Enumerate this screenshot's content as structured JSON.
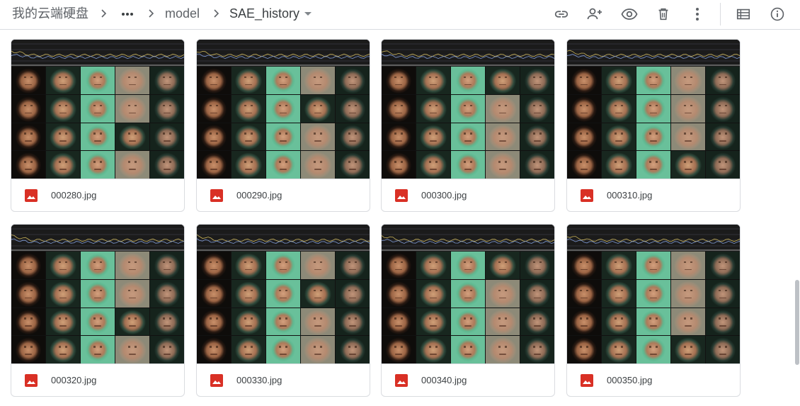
{
  "breadcrumb": {
    "root": "我的云端硬盘",
    "more_label": "More folders",
    "folder": "model",
    "current": "SAE_history"
  },
  "toolbar": {
    "icons": [
      "link-icon",
      "add-person-icon",
      "preview-eye-icon",
      "trash-icon",
      "more-vert-icon",
      "list-view-icon",
      "info-icon"
    ]
  },
  "files": [
    {
      "name": "000280.jpg"
    },
    {
      "name": "000290.jpg"
    },
    {
      "name": "000300.jpg"
    },
    {
      "name": "000310.jpg"
    },
    {
      "name": "000320.jpg"
    },
    {
      "name": "000330.jpg"
    },
    {
      "name": "000340.jpg"
    },
    {
      "name": "000350.jpg"
    }
  ],
  "colors": {
    "image_icon": "#d93025",
    "icon_gray": "#5f6368",
    "border": "#dadce0"
  }
}
